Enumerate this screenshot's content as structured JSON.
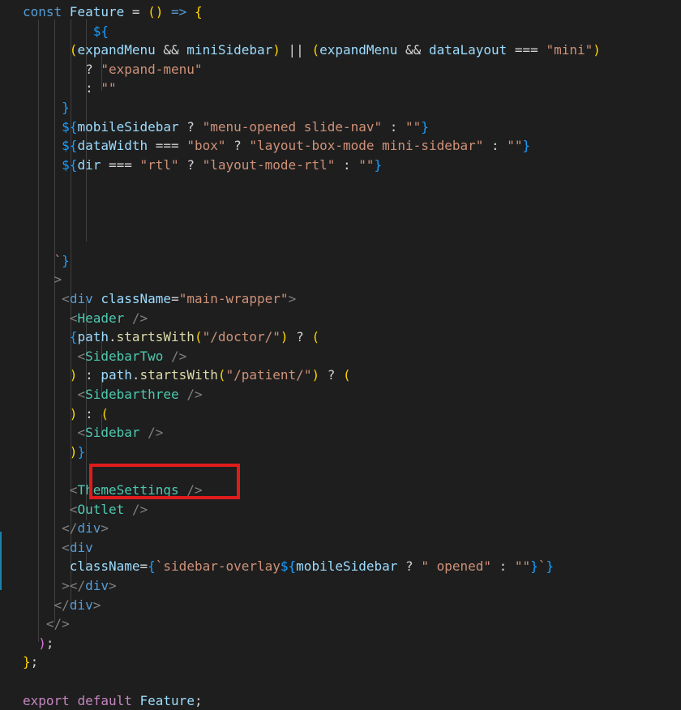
{
  "lines": [
    [
      [
        "kw",
        "const "
      ],
      [
        "var",
        "Feature"
      ],
      [
        "plain",
        " = "
      ],
      [
        "br1",
        "()"
      ],
      [
        "plain",
        " "
      ],
      [
        "kw",
        "=>"
      ],
      [
        "plain",
        " "
      ],
      [
        "br1",
        "{"
      ]
    ],
    [
      [
        "plain",
        "         "
      ],
      [
        "br3",
        "$"
      ],
      [
        "br3",
        "{"
      ]
    ],
    [
      [
        "plain",
        "      "
      ],
      [
        "br1",
        "("
      ],
      [
        "var",
        "expandMenu"
      ],
      [
        "plain",
        " && "
      ],
      [
        "var",
        "miniSidebar"
      ],
      [
        "br1",
        ")"
      ],
      [
        "plain",
        " || "
      ],
      [
        "br1",
        "("
      ],
      [
        "var",
        "expandMenu"
      ],
      [
        "plain",
        " && "
      ],
      [
        "var",
        "dataLayout"
      ],
      [
        "plain",
        " === "
      ],
      [
        "str",
        "\"mini\""
      ],
      [
        "br1",
        ")"
      ]
    ],
    [
      [
        "plain",
        "        ? "
      ],
      [
        "str",
        "\"expand-menu\""
      ]
    ],
    [
      [
        "plain",
        "        : "
      ],
      [
        "str",
        "\"\""
      ]
    ],
    [
      [
        "plain",
        "     "
      ],
      [
        "br3",
        "}"
      ]
    ],
    [
      [
        "plain",
        "     "
      ],
      [
        "br3",
        "${"
      ],
      [
        "var",
        "mobileSidebar"
      ],
      [
        "plain",
        " ? "
      ],
      [
        "str",
        "\"menu-opened slide-nav\""
      ],
      [
        "plain",
        " : "
      ],
      [
        "str",
        "\"\""
      ],
      [
        "br3",
        "}"
      ]
    ],
    [
      [
        "plain",
        "     "
      ],
      [
        "br3",
        "${"
      ],
      [
        "var",
        "dataWidth"
      ],
      [
        "plain",
        " === "
      ],
      [
        "str",
        "\"box\""
      ],
      [
        "plain",
        " ? "
      ],
      [
        "str",
        "\"layout-box-mode mini-sidebar\""
      ],
      [
        "plain",
        " : "
      ],
      [
        "str",
        "\"\""
      ],
      [
        "br3",
        "}"
      ]
    ],
    [
      [
        "plain",
        "     "
      ],
      [
        "br3",
        "${"
      ],
      [
        "var",
        "dir"
      ],
      [
        "plain",
        " === "
      ],
      [
        "str",
        "\"rtl\""
      ],
      [
        "plain",
        " ? "
      ],
      [
        "str",
        "\"layout-mode-rtl\""
      ],
      [
        "plain",
        " : "
      ],
      [
        "str",
        "\"\""
      ],
      [
        "br3",
        "}"
      ]
    ],
    [],
    [],
    [],
    [],
    [
      [
        "plain",
        "    "
      ],
      [
        "str",
        "`"
      ],
      [
        "br3",
        "}"
      ]
    ],
    [
      [
        "plain",
        "    "
      ],
      [
        "punc",
        ">"
      ]
    ],
    [
      [
        "plain",
        "     "
      ],
      [
        "punc",
        "<"
      ],
      [
        "kw",
        "div"
      ],
      [
        "plain",
        " "
      ],
      [
        "var",
        "className"
      ],
      [
        "plain",
        "="
      ],
      [
        "str",
        "\"main-wrapper\""
      ],
      [
        "punc",
        ">"
      ]
    ],
    [
      [
        "plain",
        "      "
      ],
      [
        "punc",
        "<"
      ],
      [
        "tag",
        "Header"
      ],
      [
        "plain",
        " "
      ],
      [
        "punc",
        "/>"
      ]
    ],
    [
      [
        "plain",
        "      "
      ],
      [
        "br3",
        "{"
      ],
      [
        "var",
        "path"
      ],
      [
        "plain",
        "."
      ],
      [
        "fn",
        "startsWith"
      ],
      [
        "br1",
        "("
      ],
      [
        "str",
        "\"/doctor/\""
      ],
      [
        "br1",
        ")"
      ],
      [
        "plain",
        " ? "
      ],
      [
        "br1",
        "("
      ]
    ],
    [
      [
        "plain",
        "       "
      ],
      [
        "punc",
        "<"
      ],
      [
        "tag",
        "SidebarTwo"
      ],
      [
        "plain",
        " "
      ],
      [
        "punc",
        "/>"
      ]
    ],
    [
      [
        "plain",
        "      "
      ],
      [
        "br1",
        ")"
      ],
      [
        "plain",
        " : "
      ],
      [
        "var",
        "path"
      ],
      [
        "plain",
        "."
      ],
      [
        "fn",
        "startsWith"
      ],
      [
        "br1",
        "("
      ],
      [
        "str",
        "\"/patient/\""
      ],
      [
        "br1",
        ")"
      ],
      [
        "plain",
        " ? "
      ],
      [
        "br1",
        "("
      ]
    ],
    [
      [
        "plain",
        "       "
      ],
      [
        "punc",
        "<"
      ],
      [
        "tag",
        "Sidebarthree"
      ],
      [
        "plain",
        " "
      ],
      [
        "punc",
        "/>"
      ]
    ],
    [
      [
        "plain",
        "      "
      ],
      [
        "br1",
        ")"
      ],
      [
        "plain",
        " : "
      ],
      [
        "br1",
        "("
      ]
    ],
    [
      [
        "plain",
        "       "
      ],
      [
        "punc",
        "<"
      ],
      [
        "tag",
        "Sidebar"
      ],
      [
        "plain",
        " "
      ],
      [
        "punc",
        "/>"
      ]
    ],
    [
      [
        "plain",
        "      "
      ],
      [
        "br1",
        ")"
      ],
      [
        "br3",
        "}"
      ]
    ],
    [],
    [
      [
        "plain",
        "      "
      ],
      [
        "punc",
        "<"
      ],
      [
        "tag",
        "ThemeSettings"
      ],
      [
        "plain",
        " "
      ],
      [
        "punc",
        "/>"
      ]
    ],
    [
      [
        "plain",
        "      "
      ],
      [
        "punc",
        "<"
      ],
      [
        "tag",
        "Outlet"
      ],
      [
        "plain",
        " "
      ],
      [
        "punc",
        "/>"
      ]
    ],
    [
      [
        "plain",
        "     "
      ],
      [
        "punc",
        "</"
      ],
      [
        "kw",
        "div"
      ],
      [
        "punc",
        ">"
      ]
    ],
    [
      [
        "plain",
        "     "
      ],
      [
        "punc",
        "<"
      ],
      [
        "kw",
        "div"
      ]
    ],
    [
      [
        "plain",
        "      "
      ],
      [
        "var",
        "className"
      ],
      [
        "plain",
        "="
      ],
      [
        "br3",
        "{"
      ],
      [
        "str",
        "`sidebar-overlay"
      ],
      [
        "br3",
        "${"
      ],
      [
        "var",
        "mobileSidebar"
      ],
      [
        "plain",
        " ? "
      ],
      [
        "str",
        "\" opened\""
      ],
      [
        "plain",
        " : "
      ],
      [
        "str",
        "\"\""
      ],
      [
        "br3",
        "}"
      ],
      [
        "str",
        "`"
      ],
      [
        "br3",
        "}"
      ]
    ],
    [
      [
        "plain",
        "     "
      ],
      [
        "punc",
        "></"
      ],
      [
        "kw",
        "div"
      ],
      [
        "punc",
        ">"
      ]
    ],
    [
      [
        "plain",
        "    "
      ],
      [
        "punc",
        "</"
      ],
      [
        "kw",
        "div"
      ],
      [
        "punc",
        ">"
      ]
    ],
    [
      [
        "plain",
        "   "
      ],
      [
        "punc",
        "</>"
      ]
    ],
    [
      [
        "plain",
        "  "
      ],
      [
        "br2",
        ")"
      ],
      [
        "plain",
        ";"
      ]
    ],
    [
      [
        "br1",
        "}"
      ],
      [
        "plain",
        ";"
      ]
    ],
    [],
    [
      [
        "ctrl",
        "export"
      ],
      [
        "plain",
        " "
      ],
      [
        "ctrl",
        "default"
      ],
      [
        "plain",
        " "
      ],
      [
        "var",
        "Feature"
      ],
      [
        "plain",
        ";"
      ]
    ]
  ]
}
